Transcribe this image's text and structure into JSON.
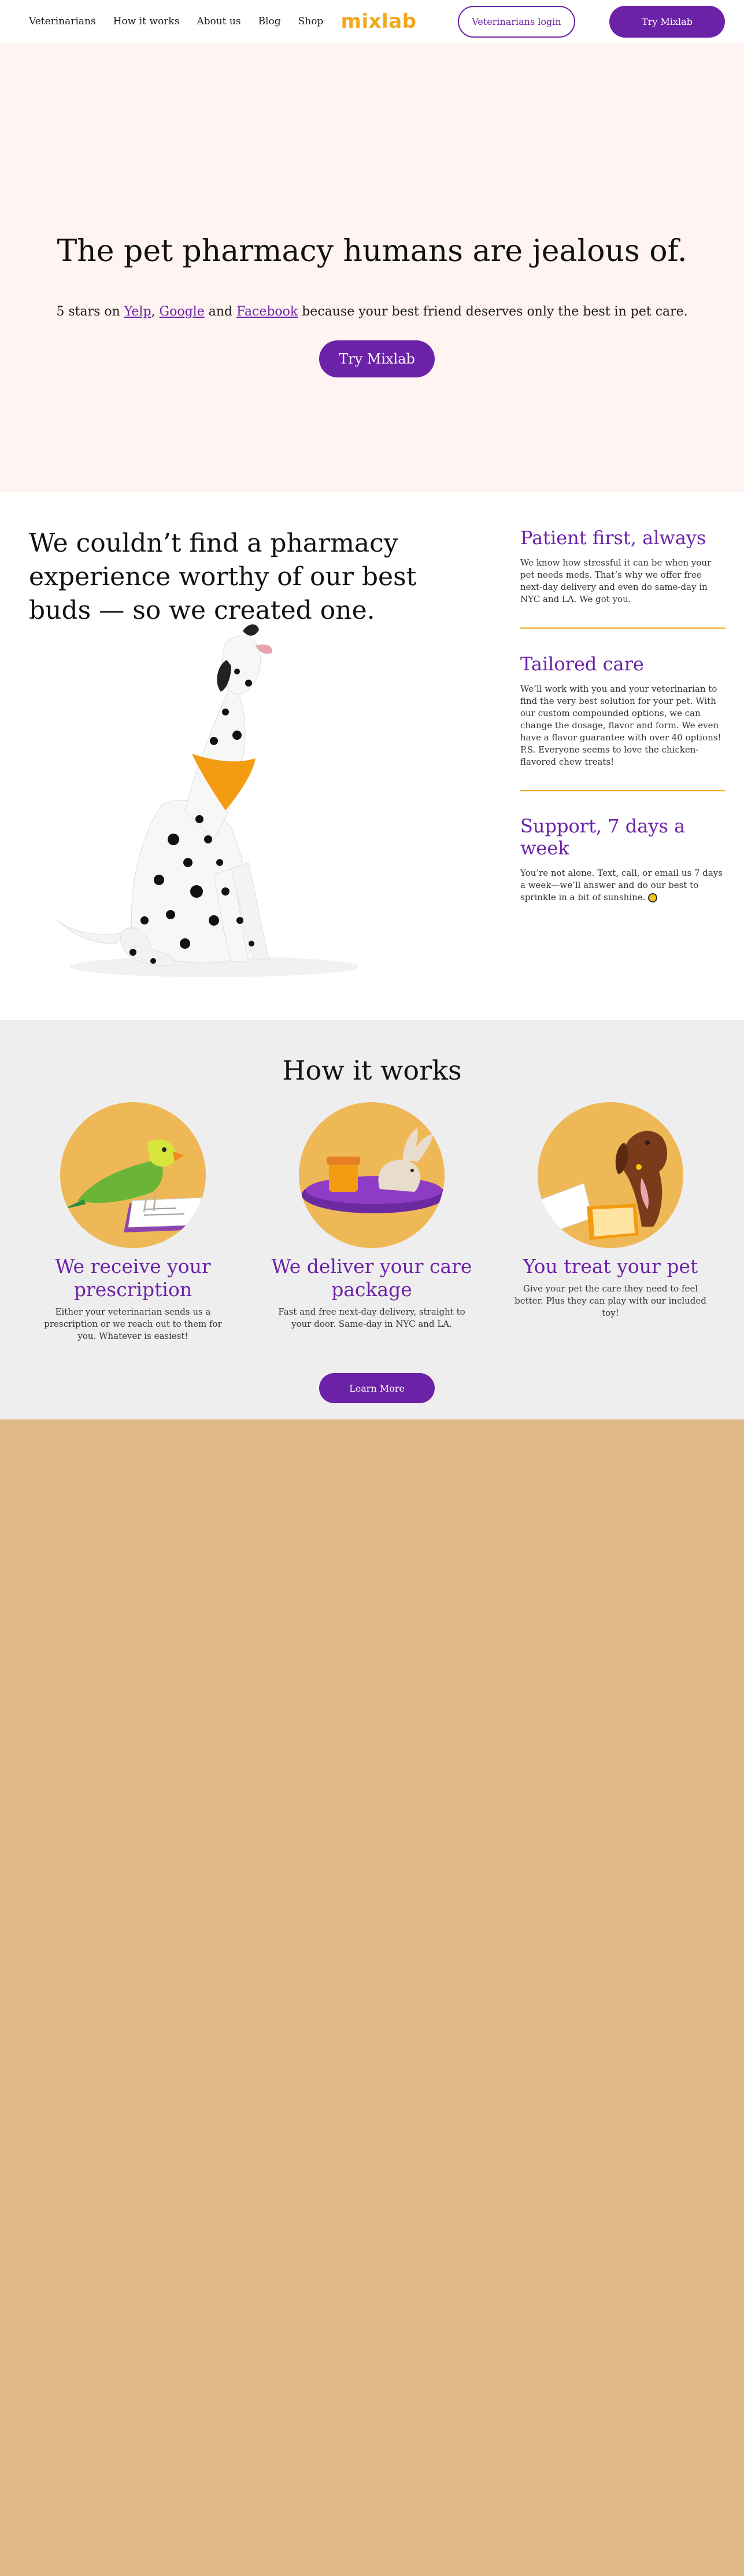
{
  "nav": {
    "links": [
      "Veterinarians",
      "How it works",
      "About us",
      "Blog",
      "Shop"
    ],
    "logo": "mixlab",
    "vet_login": "Veterinarians login",
    "try": "Try Mixlab"
  },
  "hero": {
    "title": "The pet pharmacy humans are jealous of.",
    "sub_prefix": "5 stars on ",
    "yelp": "Yelp",
    "comma": ", ",
    "google": "Google",
    "and": " and ",
    "facebook": "Facebook",
    "sub_suffix": " because your best friend deserves only the best in pet care.",
    "cta": "Try Mixlab"
  },
  "story": {
    "title": "We couldn’t find a pharmacy experience worthy of our best buds — so we created one.",
    "features": [
      {
        "title": "Patient first, always",
        "text": "We know how stressful it can be when your pet needs meds. That’s why we offer free next-day delivery and even do same-day in NYC and LA. We got you."
      },
      {
        "title": "Tailored care",
        "text": "We’ll work with you and your veterinarian to find the very best solution for your pet. With our custom compounded options, we can change the dosage, flavor and form. We even have a flavor guarantee with over 40 options! P.S. Everyone seems to love the chicken-flavored chew treats!"
      },
      {
        "title": "Support, 7 days a week",
        "text": "You’re not alone. Text, call, or email us 7 days a week—we’ll answer and do our best to sprinkle in a bit of sunshine."
      }
    ]
  },
  "how": {
    "title": "How it works",
    "steps": [
      {
        "title": "We receive your prescription",
        "text": "Either your veterinarian sends us a prescription or we reach out to them for you. Whatever is easiest!"
      },
      {
        "title": "We deliver your care package",
        "text": "Fast and free next-day delivery, straight to your door. Same-day in NYC and LA."
      },
      {
        "title": "You treat your pet",
        "text": "Give your pet the care they need to feel better. Plus they can play with our included toy!"
      }
    ],
    "cta": "Learn More"
  },
  "colors": {
    "accent": "#6c22a6",
    "brand_yellow": "#f2a81d",
    "hero_bg": "#fff4f2",
    "how_bg": "#eeeeee",
    "footer_bg": "#deb887"
  }
}
